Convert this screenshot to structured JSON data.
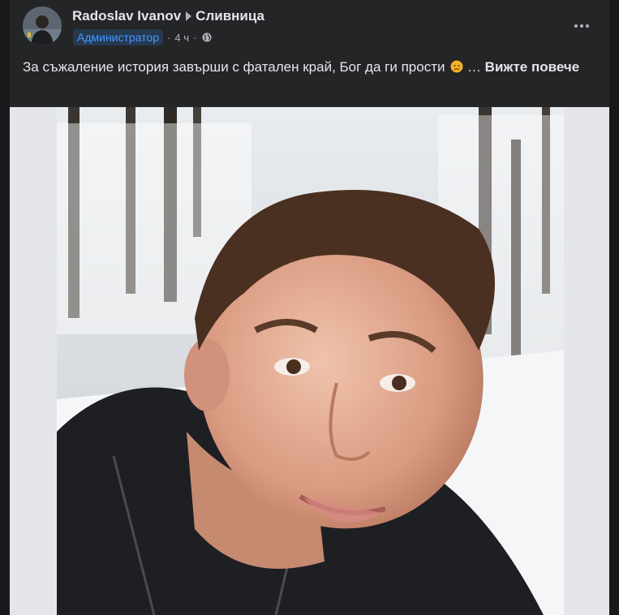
{
  "post": {
    "author": "Radoslav Ivanov",
    "group": "Сливница",
    "role_badge": "Администратор",
    "time": "4 ч",
    "separator": "·",
    "text": "За съжаление история завърши с фатален край, Бог да ги прости",
    "ellipsis": " … ",
    "see_more": "Вижте повече",
    "icons": {
      "arrow": "caret-right-icon",
      "audience": "globe-icon",
      "menu": "more-horizontal-icon",
      "emoji": "sad-face-emoji"
    },
    "colors": {
      "background": "#242526",
      "badge_bg": "#263951",
      "badge_text": "#4599ff",
      "media_frame": "#e4e6eb"
    }
  }
}
